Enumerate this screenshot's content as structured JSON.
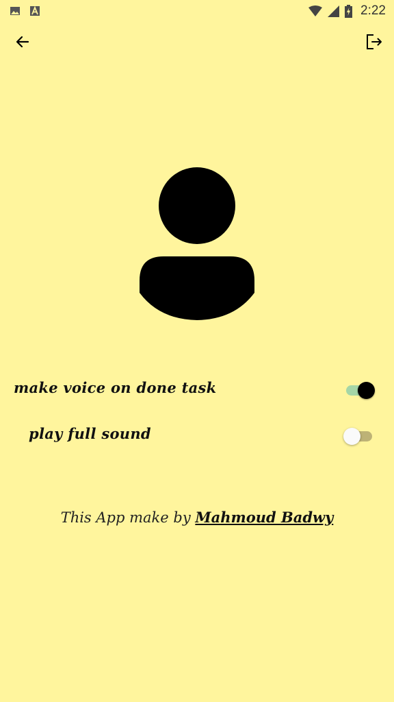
{
  "status_bar": {
    "time": "2:22",
    "left_icons": [
      "image-icon",
      "font-a-icon"
    ],
    "right_icons": [
      "wifi-icon",
      "signal-icon",
      "battery-charging-icon"
    ]
  },
  "app_bar": {
    "back_icon": "arrow-back-icon",
    "logout_icon": "logout-icon"
  },
  "settings": {
    "voice_on_done": {
      "label": "make voice on done task",
      "enabled": true
    },
    "play_full_sound": {
      "label": "play full sound",
      "enabled": false
    }
  },
  "credit": {
    "prefix": "This App make by ",
    "author": "Mahmoud Badwy"
  },
  "colors": {
    "background": "#fff59d",
    "switch_on_track": "#a5d6a7",
    "switch_on_thumb": "#000000",
    "switch_off_track": "#bdb276",
    "switch_off_thumb": "#fafafa"
  }
}
